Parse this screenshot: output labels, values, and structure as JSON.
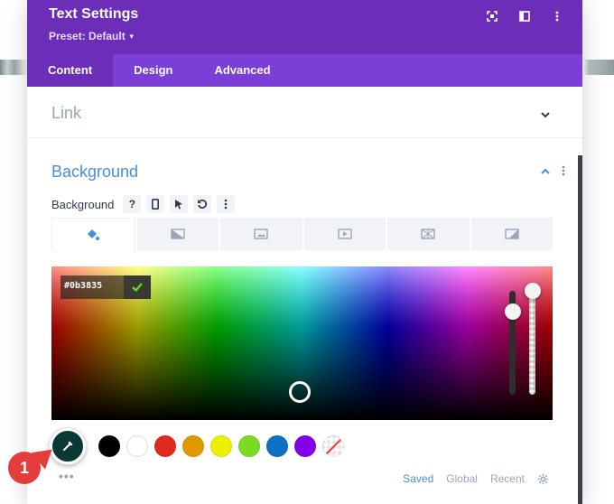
{
  "header": {
    "title": "Text Settings",
    "preset": "Preset: Default",
    "icons": [
      "expand-icon",
      "sidebar-layout-icon",
      "more-vertical-icon"
    ]
  },
  "tabs": [
    "Content",
    "Design",
    "Advanced"
  ],
  "active_tab": "Content",
  "link_section": {
    "title": "Link"
  },
  "background_section": {
    "title": "Background",
    "label": "Background",
    "label_buttons": [
      "?",
      "phone-icon",
      "cursor-icon",
      "undo-icon",
      "more-vertical-icon"
    ],
    "type_tabs": [
      "color-icon",
      "gradient-icon",
      "image-icon",
      "video-icon",
      "pattern-icon",
      "mask-icon"
    ],
    "color_picker": {
      "hex_value": "#0b3835"
    }
  },
  "swatches": {
    "active": "#0b3835",
    "presets": [
      "#000000",
      "#ffffff",
      "#e02b20",
      "#e09900",
      "#edf000",
      "#7cda24",
      "#0c71c3",
      "#8300e9",
      "none"
    ]
  },
  "footer": {
    "saved": "Saved",
    "global": "Global",
    "recent": "Recent",
    "more": "•••"
  },
  "annotation": {
    "number": "1"
  },
  "colors": {
    "header": "#6c2eb9",
    "tabs": "#7b3ed6",
    "accent": "#4a8fd6",
    "badge": "#e53c3c"
  }
}
